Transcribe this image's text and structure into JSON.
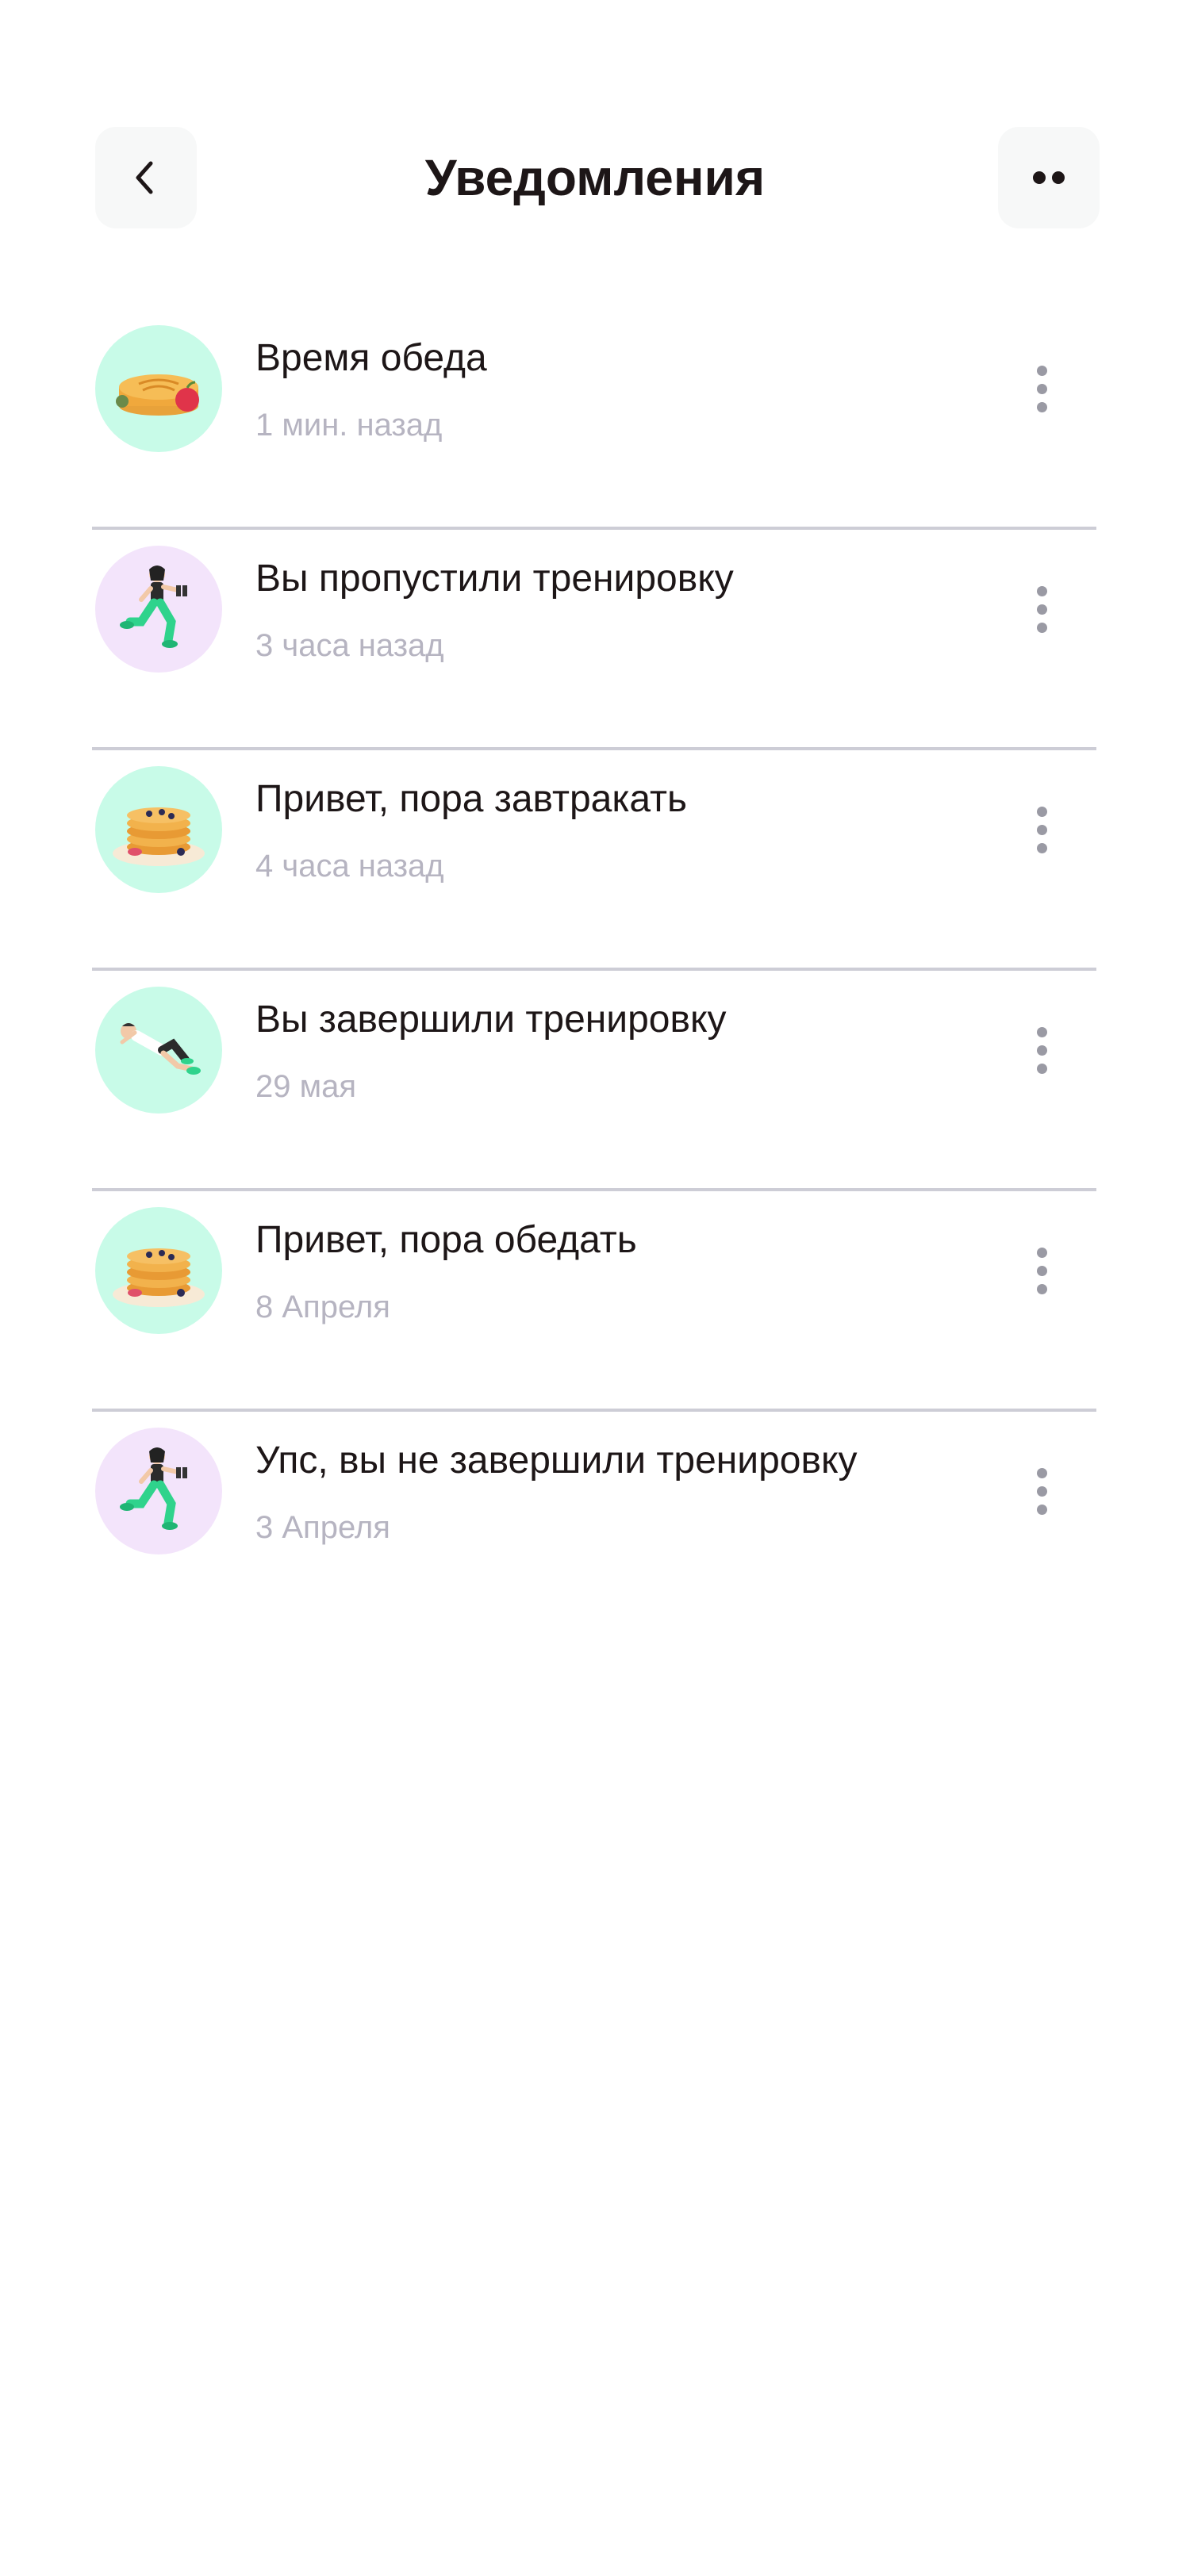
{
  "header": {
    "title": "Уведомления",
    "back_icon": "chevron-left-icon",
    "more_icon": "more-dots-icon"
  },
  "colors": {
    "title": "#1d1617",
    "subtitle": "#b6b4c1",
    "divider": "#cdcdd6",
    "food_avatar_bg": "#c8fbe8",
    "workout_avatar_bg": "#f3e4fb",
    "header_button_bg": "#f7f8f8"
  },
  "notifications": [
    {
      "title": "Время обеда",
      "time": "1 мин. назад",
      "icon": "pie-with-apple-icon"
    },
    {
      "title": "Вы пропустили тренировку",
      "time": "3 часа назад",
      "icon": "woman-lunge-dumbbell-icon"
    },
    {
      "title": "Привет, пора завтракать",
      "time": "4 часа назад",
      "icon": "pancakes-icon"
    },
    {
      "title": "Вы завершили тренировку",
      "time": "29 мая",
      "icon": "man-crunch-exercise-icon"
    },
    {
      "title": "Привет, пора обедать",
      "time": "8 Апреля",
      "icon": "pancakes-icon"
    },
    {
      "title": "Упс, вы не завершили тренировку",
      "time": "3 Апреля",
      "icon": "woman-lunge-dumbbell-icon"
    }
  ]
}
